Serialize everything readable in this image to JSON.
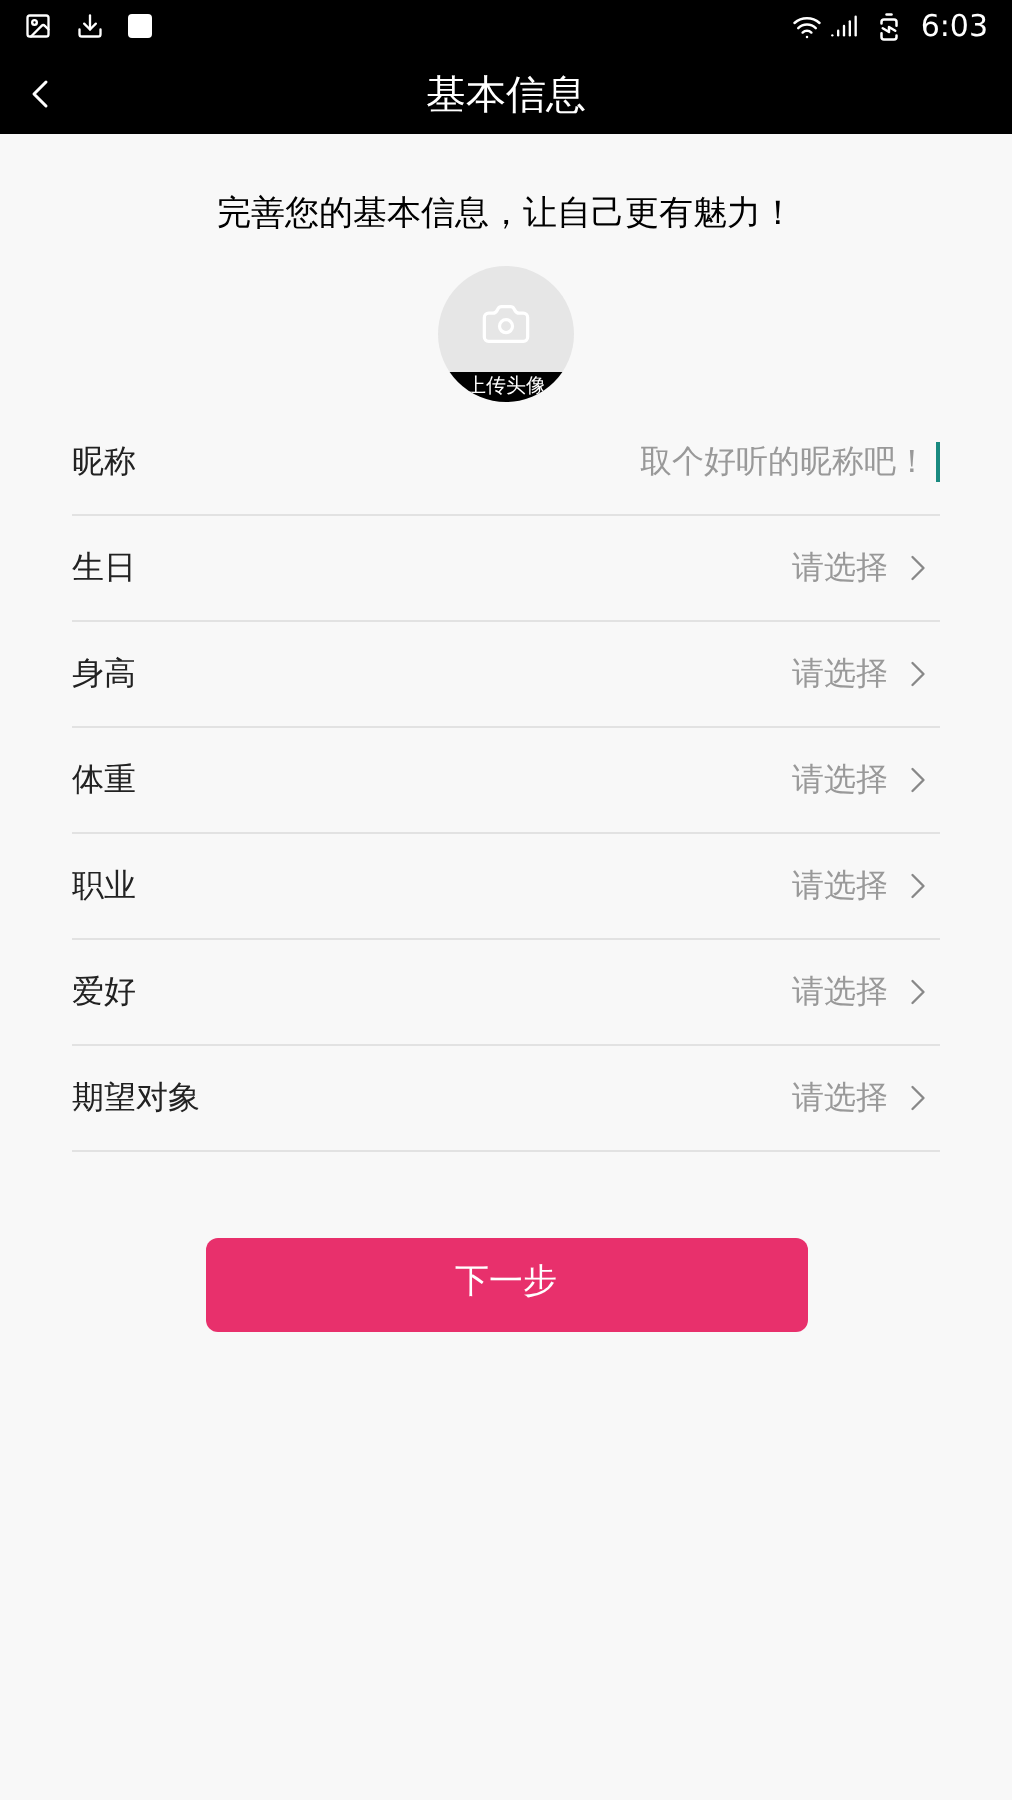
{
  "status_bar": {
    "time": "6:03"
  },
  "header": {
    "title": "基本信息"
  },
  "intro": "完善您的基本信息，让自己更有魅力！",
  "avatar": {
    "label": "上传头像"
  },
  "fields": [
    {
      "kind": "input",
      "label": "昵称",
      "placeholder": "取个好听的昵称吧！"
    },
    {
      "kind": "select",
      "label": "生日",
      "value": "请选择"
    },
    {
      "kind": "select",
      "label": "身高",
      "value": "请选择"
    },
    {
      "kind": "select",
      "label": "体重",
      "value": "请选择"
    },
    {
      "kind": "select",
      "label": "职业",
      "value": "请选择"
    },
    {
      "kind": "select",
      "label": "爱好",
      "value": "请选择"
    },
    {
      "kind": "select",
      "label": "期望对象",
      "value": "请选择"
    }
  ],
  "next_button": "下一步"
}
